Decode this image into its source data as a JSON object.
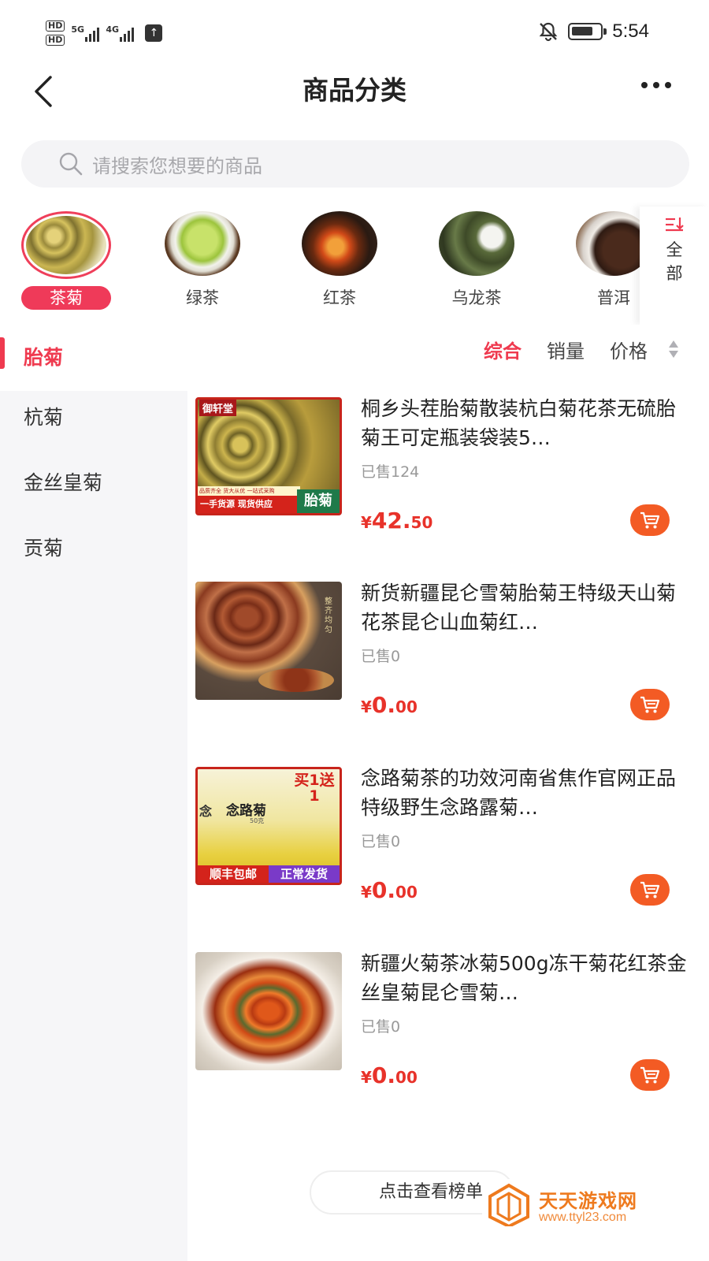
{
  "status_bar": {
    "hd1": "HD",
    "hd2": "HD",
    "net1": "5G",
    "net2": "4G",
    "time": "5:54"
  },
  "header": {
    "title": "商品分类"
  },
  "search": {
    "placeholder": "请搜索您想要的商品"
  },
  "categories": [
    {
      "label": "茶菊",
      "active": true
    },
    {
      "label": "绿茶",
      "active": false
    },
    {
      "label": "红茶",
      "active": false
    },
    {
      "label": "乌龙茶",
      "active": false
    },
    {
      "label": "普洱",
      "active": false
    }
  ],
  "all_button": {
    "label": "全部"
  },
  "subcategories": [
    {
      "label": "胎菊",
      "active": true
    },
    {
      "label": "杭菊",
      "active": false
    },
    {
      "label": "金丝皇菊",
      "active": false
    },
    {
      "label": "贡菊",
      "active": false
    }
  ],
  "sort": {
    "comprehensive": "综合",
    "sales": "销量",
    "price": "价格"
  },
  "products": [
    {
      "name": "桐乡头茬胎菊散装杭白菊花茶无硫胎菊王可定瓶装袋装5…",
      "sold": "已售124",
      "currency": "¥",
      "price_int": "42.",
      "price_dec": "50",
      "image_text": {
        "brand": "御轩堂",
        "banner": "一手货源 现货供应",
        "tag": "胎菊",
        "sub": "品质齐全 货大从优 一站式采购"
      }
    },
    {
      "name": "新货新疆昆仑雪菊胎菊王特级天山菊花茶昆仑山血菊红…",
      "sold": "已售0",
      "currency": "¥",
      "price_int": "0.",
      "price_dec": "00",
      "image_text": {
        "side": "整齐均匀"
      }
    },
    {
      "name": "念路菊茶的功效河南省焦作官网正品特级野生念路露菊…",
      "sold": "已售0",
      "currency": "¥",
      "price_int": "0.",
      "price_dec": "00",
      "image_text": {
        "jar": "念路菊",
        "jar_sub": "50克",
        "promo": "买1送1",
        "ship": "顺丰包邮",
        "normal": "正常发货",
        "nian": "念"
      }
    },
    {
      "name": "新疆火菊茶冰菊500g冻干菊花红茶金丝皇菊昆仑雪菊…",
      "sold": "已售0",
      "currency": "¥",
      "price_int": "0.",
      "price_dec": "00",
      "image_text": {}
    }
  ],
  "view_more": "点击查看榜单",
  "watermark": {
    "name": "天天游戏网",
    "url": "www.ttyl23.com"
  },
  "colors": {
    "accent_red": "#ef3a4f",
    "price_red": "#e8322a",
    "cart_orange": "#f35b24",
    "watermark_orange": "#ee7a1e"
  },
  "icons": [
    "back-arrow-icon",
    "more-dots-icon",
    "search-icon",
    "sort-icon",
    "cart-icon",
    "mute-bell-icon",
    "battery-icon",
    "upload-icon"
  ]
}
